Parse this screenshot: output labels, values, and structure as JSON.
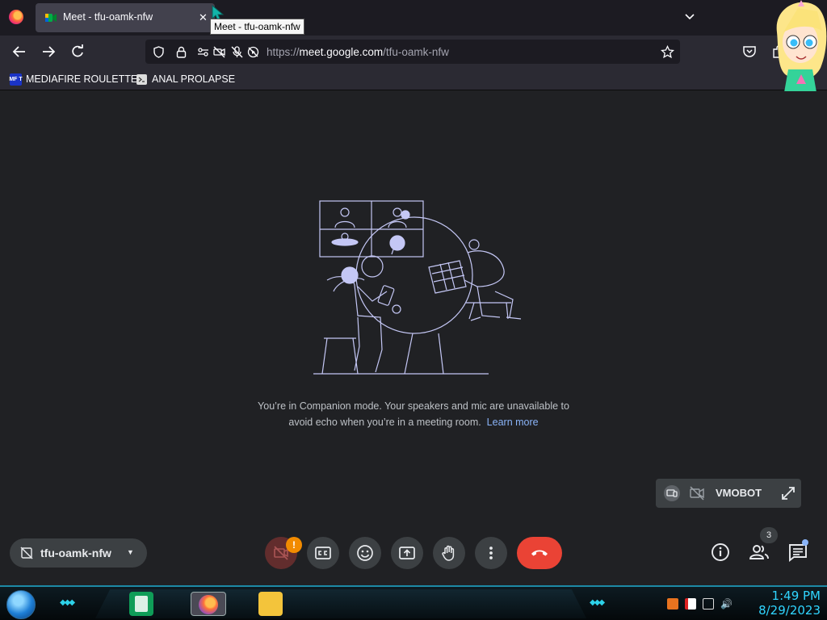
{
  "browser": {
    "tab_title": "Meet - tfu-oamk-nfw",
    "tab_close": "✕",
    "tooltip": "Meet - tfu-oamk-nfw",
    "url_prefix": "https://",
    "url_host": "meet.google.com",
    "url_path": "/tfu-oamk-nfw",
    "bookmarks": [
      {
        "label": "MEDIAFIRE ROULETTER",
        "icon": "mediafire-icon",
        "icon_text": "MF T",
        "color": "#1a33c7"
      },
      {
        "label": "ANAL PROLAPSE",
        "icon": "page-icon",
        "icon_text": "",
        "color": "#dddddd"
      }
    ]
  },
  "meet": {
    "companion_message": "You’re in Companion mode. Your speakers and mic are unavailable to avoid echo when you’re in a meeting room.",
    "learn_more": "Learn more",
    "tile_name": "VMOBOT",
    "meeting_code": "tfu-oamk-nfw",
    "camera_alert": "!",
    "people_count": "3",
    "colors": {
      "hangup": "#ea4335",
      "accent": "#8ab4f8",
      "background": "#202124",
      "alert": "#f28b00"
    }
  },
  "taskbar": {
    "time": "1:49 PM",
    "date": "8/29/2023"
  }
}
